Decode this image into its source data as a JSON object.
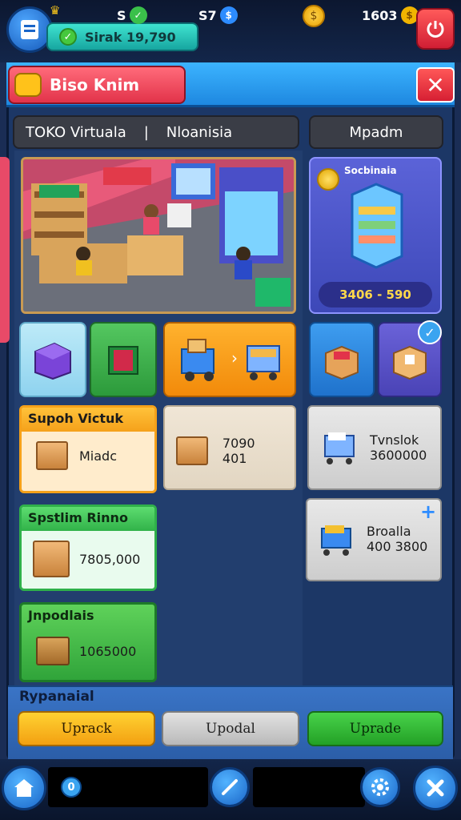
{
  "top_bar": {
    "cash_label": "Sirak 19,790",
    "res1": "S",
    "res2": "S7",
    "res3": "1603"
  },
  "panel": {
    "title": "Biso Knim",
    "close": "✕",
    "tab_left_1": "TOKO Virtuala",
    "tab_sep": "|",
    "tab_left_2": "Nloanisia",
    "tab_right": "Mpadm"
  },
  "offer": {
    "title": "Socbinaia",
    "price": "3406 - 590"
  },
  "cards": {
    "orange": {
      "title": "Supoh Victuk",
      "value": "Miadc"
    },
    "middle": {
      "value": "7090 401"
    },
    "green1": {
      "title": "Spstlim Rinno",
      "value": "7805,000"
    },
    "green2": {
      "title": "Jnpodlais",
      "value": "1065000"
    },
    "right1": {
      "title": "Tvnslok",
      "value": "3600000"
    },
    "right2": {
      "title": "Broalla",
      "value": "400 3800"
    }
  },
  "footer": {
    "label": "Rypanaial",
    "btn1": "Uprack",
    "btn2": "Upodal",
    "btn3": "Uprade"
  },
  "bottom_nav": {
    "small_badge": "0"
  },
  "colors": {
    "accent": "#3cb4ff",
    "title_red": "#e2334a",
    "panel_bg": "#1c3766"
  }
}
